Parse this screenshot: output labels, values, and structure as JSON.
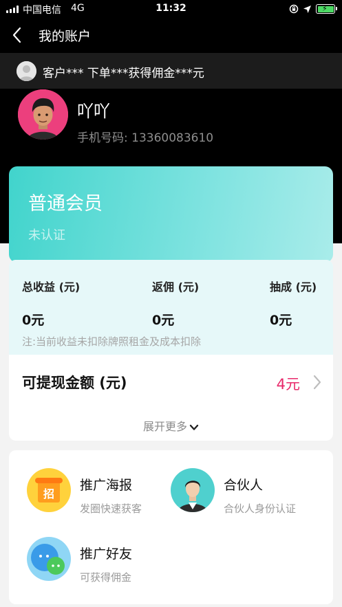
{
  "status_bar": {
    "carrier": "中国电信",
    "network": "4G",
    "time": "11:32"
  },
  "nav": {
    "title": "我的账户"
  },
  "notice": {
    "text": "客户*** 下单***获得佣金***元"
  },
  "profile": {
    "name": "吖吖",
    "phone": "手机号码: 13360083610"
  },
  "member": {
    "level": "普通会员",
    "status": "未认证"
  },
  "earnings": {
    "total_label": "总收益 (元)",
    "total_value": "0元",
    "rebate_label": "返佣 (元)",
    "rebate_value": "0元",
    "commission_label": "抽成 (元)",
    "commission_value": "0元",
    "note": "注:当前收益未扣除牌照租金及成本扣除",
    "withdraw_label": "可提现金额 (元)",
    "withdraw_value": "4元",
    "expand_label": "展开更多"
  },
  "tools": [
    {
      "title": "推广海报",
      "subtitle": "发圈快速获客",
      "icon": "poster-icon"
    },
    {
      "title": "合伙人",
      "subtitle": "合伙人身份认证",
      "icon": "partner-icon"
    },
    {
      "title": "推广好友",
      "subtitle": "可获得佣金",
      "icon": "invite-friends-icon"
    }
  ],
  "colors": {
    "background_dark": "#000000",
    "notice_bar": "#1c1c1c",
    "member_card_start": "#41d4cc",
    "member_card_end": "#a9ecea",
    "earnings_panel": "#e6f8f9",
    "withdraw_amount": "#e8286a",
    "page_background": "#f3f3f3"
  }
}
